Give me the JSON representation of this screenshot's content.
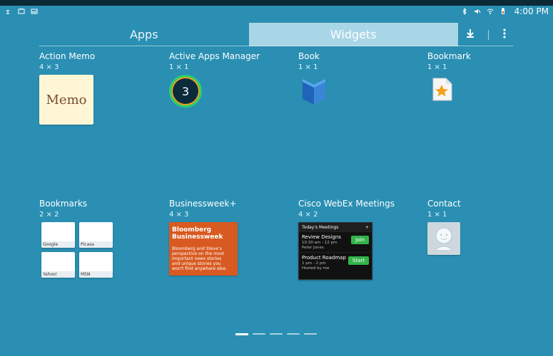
{
  "status_bar": {
    "time": "4:00 PM",
    "left_icons": [
      "nyt-icon",
      "tv-icon",
      "image-icon"
    ],
    "right_icons": [
      "bluetooth-icon",
      "mute-icon",
      "wifi-icon",
      "battery-icon"
    ]
  },
  "tabs": [
    {
      "label": "Apps",
      "active": false
    },
    {
      "label": "Widgets",
      "active": true
    }
  ],
  "actions": {
    "download_icon": "download-icon",
    "more_icon": "overflow-menu-icon"
  },
  "widgets": [
    {
      "name": "Action Memo",
      "size": "4 × 3",
      "preview_text": "Memo"
    },
    {
      "name": "Active Apps Manager",
      "size": "1 × 1",
      "preview_text": "3"
    },
    {
      "name": "Book",
      "size": "1 × 1"
    },
    {
      "name": "Bookmark",
      "size": "1 × 1"
    },
    {
      "name": "Bookmarks",
      "size": "2 × 2",
      "tiles": [
        "Google",
        "Picasa",
        "Yahoo!",
        "MSN"
      ]
    },
    {
      "name": "Businessweek+",
      "size": "4 × 3",
      "preview_title": "Bloomberg Businessweek",
      "preview_text": "Bloomberg and Steve’s perspective on the most important news stories and unique stories you won't find anywhere else."
    },
    {
      "name": "Cisco WebEx Meetings",
      "size": "4 × 2",
      "preview": {
        "header": "Today's Meetings",
        "meetings": [
          {
            "title": "Review Designs",
            "time": "10:30 am - 12 pm",
            "host": "Peter Jones",
            "button": "Join"
          },
          {
            "title": "Product Roadmap",
            "time": "1 pm - 2 pm",
            "host": "Hosted by me",
            "button": "Start"
          }
        ]
      }
    },
    {
      "name": "Contact",
      "size": "1 × 1"
    }
  ],
  "pager": {
    "pages": 5,
    "current": 1
  },
  "colors": {
    "background": "#2a8fb3",
    "active_tab": "#a9d6e6",
    "status_bar": "#0b2a36"
  }
}
